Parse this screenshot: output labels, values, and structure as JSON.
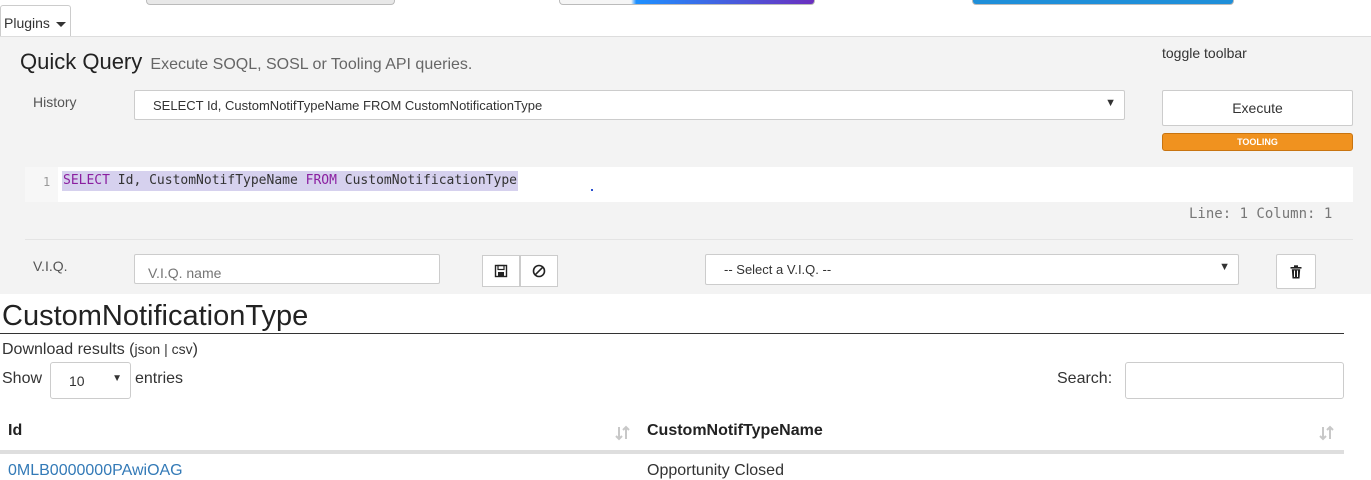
{
  "toolbar": {
    "plugins_label": "Plugins"
  },
  "query": {
    "title": "Quick Query",
    "subtitle": "Execute SOQL, SOSL or Tooling API queries.",
    "toggle_toolbar": "toggle toolbar",
    "history_label": "History",
    "history_value": "SELECT Id, CustomNotifTypeName FROM CustomNotificationType",
    "execute_label": "Execute",
    "tooling_badge": "TOOLING",
    "editor": {
      "line_number": "1",
      "kw_select": "SELECT",
      "fields": " Id, CustomNotifTypeName ",
      "kw_from": "FROM",
      "object": " CustomNotificationType"
    },
    "status": "Line: 1 Column: 1",
    "viq_label": "V.I.Q.",
    "viq_placeholder": "V.I.Q. name",
    "viq_select_value": "-- Select a V.I.Q. --"
  },
  "results": {
    "title": "CustomNotificationType",
    "download_prefix": "Download results (",
    "json_link": "json",
    "sep": " | ",
    "csv_link": "csv",
    "download_suffix": ")",
    "show_label": "Show",
    "page_size": "10",
    "entries_label": "entries",
    "search_label": "Search:",
    "columns": [
      "Id",
      "CustomNotifTypeName"
    ],
    "rows": [
      {
        "id": "0MLB0000000PAwiOAG",
        "name": "Opportunity Closed"
      }
    ]
  },
  "colors": {
    "tooling_badge": "#f0921f",
    "link": "#337ab7",
    "keyword": "#8b1fa0",
    "selection": "#d6d1ee"
  }
}
